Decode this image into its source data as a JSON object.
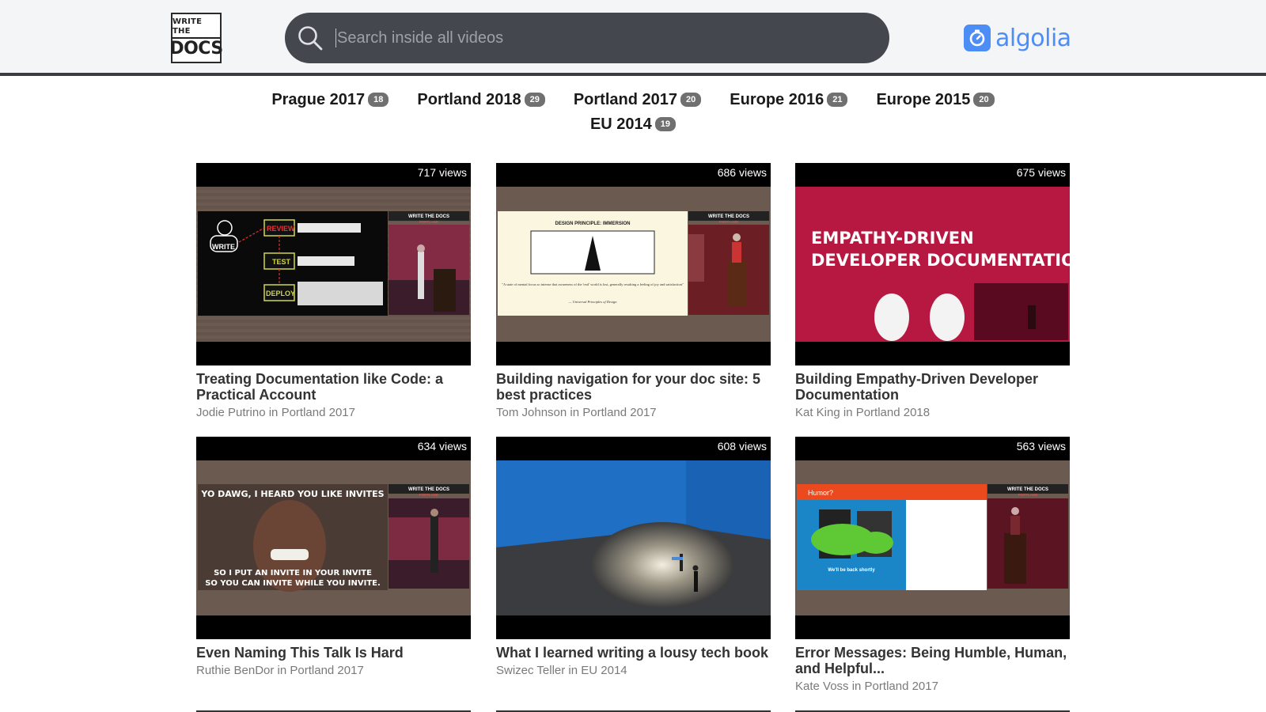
{
  "header": {
    "logo_line1": "WRITE THE",
    "logo_line2": "DOCS",
    "search_placeholder": "Search inside all videos",
    "algolia_label": "algolia"
  },
  "events": [
    {
      "name": "Prague 2017",
      "count": "18"
    },
    {
      "name": "Portland 2018",
      "count": "29"
    },
    {
      "name": "Portland 2017",
      "count": "20"
    },
    {
      "name": "Europe 2016",
      "count": "21"
    },
    {
      "name": "Europe 2015",
      "count": "20"
    },
    {
      "name": "EU 2014",
      "count": "19"
    }
  ],
  "videos": [
    {
      "views": "717 views",
      "title": "Treating Documentation like Code: a Practical Account",
      "speaker": "Jodie Putrino in Portland 2017",
      "slide": [
        "WRITE",
        "REVIEW",
        "TEST",
        "DEPLOY"
      ],
      "brand": "WRITE THE DOCS",
      "brand_sub": "PORTLAND"
    },
    {
      "views": "686 views",
      "title": "Building navigation for your doc site: 5 best practices",
      "speaker": "Tom Johnson in Portland 2017",
      "slide": [
        "DESIGN PRINCIPLE: IMMERSION",
        "\"A state of mental focus so intense that awareness of the 'real' world is lost, generally resulting a feeling of joy and satisfaction\"",
        "— Universal Principles of Design"
      ],
      "brand": "WRITE THE DOCS",
      "brand_sub": "PORTLAND"
    },
    {
      "views": "675 views",
      "title": "Building Empathy-Driven Developer Documentation",
      "speaker": "Kat King in Portland 2018",
      "slide": [
        "EMPATHY-DRIVEN",
        "DEVELOPER DOCUMENTATION"
      ]
    },
    {
      "views": "634 views",
      "title": "Even Naming This Talk Is Hard",
      "speaker": "Ruthie BenDor in Portland 2017",
      "slide": [
        "YO DAWG, I HEARD YOU LIKE INVITES",
        "SO I PUT AN INVITE IN YOUR INVITE",
        "SO YOU CAN INVITE WHILE YOU INVITE."
      ],
      "brand": "WRITE THE DOCS",
      "brand_sub": "PORTLAND"
    },
    {
      "views": "608 views",
      "title": "What I learned writing a lousy tech book",
      "speaker": "Swizec Teller in EU 2014"
    },
    {
      "views": "563 views",
      "title": "Error Messages: Being Humble, Human, and Helpful...",
      "speaker": "Kate Voss in Portland 2017",
      "slide": [
        "Humor?",
        "We'll be back shortly"
      ],
      "brand": "WRITE THE DOCS",
      "brand_sub": "PORTLAND"
    }
  ],
  "colors": {
    "header_bg": "#f4f5f7",
    "search_bg": "#44474d",
    "algolia_blue": "#4c8df6",
    "badge_bg": "#707070"
  }
}
